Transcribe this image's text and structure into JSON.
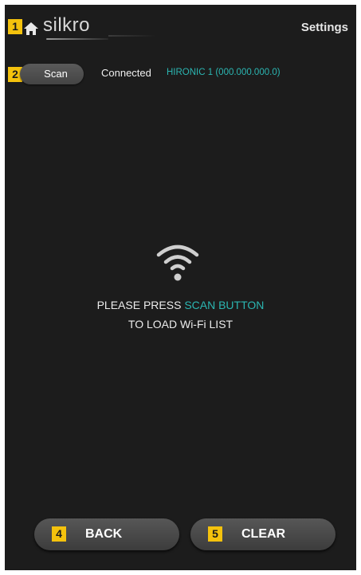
{
  "header": {
    "brand": "silkro",
    "settings_label": "Settings",
    "callout": "1"
  },
  "scan": {
    "label": "Scan",
    "callout": "2",
    "status_label": "Connected",
    "network_name": "HIRONIC 1 (000.000.000.0)"
  },
  "empty_state": {
    "icon": "wifi-icon",
    "line1_prefix": "PLEASE PRESS ",
    "line1_accent": "SCAN BUTTON",
    "line2": "TO LOAD Wi-Fi LIST"
  },
  "footer": {
    "back_label": "BACK",
    "back_callout": "4",
    "clear_label": "CLEAR",
    "clear_callout": "5"
  },
  "colors": {
    "background": "#1c1c1c",
    "accent": "#2bb6b2",
    "callout": "#f4c20d"
  }
}
